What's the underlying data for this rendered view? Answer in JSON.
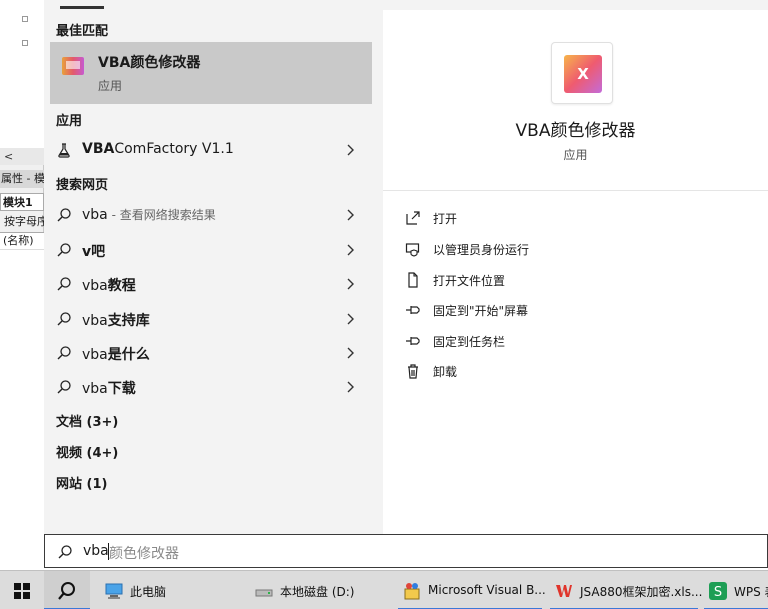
{
  "background_window": {
    "scroll_left_glyph": "<",
    "properties_title": "属性 - 模块",
    "module_name": "模块1",
    "sort_tab": "按字母序",
    "name_cell": "(名称)"
  },
  "left": {
    "best_match_header": "最佳匹配",
    "best_match": {
      "name": "VBA颜色修改器",
      "type": "应用"
    },
    "apps_header": "应用",
    "app_item": {
      "bold": "VBA",
      "rest": "ComFactory V1.1"
    },
    "web_header": "搜索网页",
    "web_items": [
      {
        "plain": "vba",
        "bold": "",
        "hint": " - 查看网络搜索结果"
      },
      {
        "plain": "",
        "bold": "v吧",
        "hint": ""
      },
      {
        "plain": "vba",
        "bold": "教程",
        "hint": ""
      },
      {
        "plain": "vba",
        "bold": "支持库",
        "hint": ""
      },
      {
        "plain": "vba",
        "bold": "是什么",
        "hint": ""
      },
      {
        "plain": "vba",
        "bold": "下载",
        "hint": ""
      }
    ],
    "docs_header": "文档 (3+)",
    "videos_header": "视频 (4+)",
    "sites_header": "网站 (1)"
  },
  "right": {
    "app_name": "VBA颜色修改器",
    "app_type": "应用",
    "icon_text": "X",
    "actions": [
      {
        "label": "打开",
        "icon": "open-icon"
      },
      {
        "label": "以管理员身份运行",
        "icon": "run-as-admin-icon"
      },
      {
        "label": "打开文件位置",
        "icon": "file-location-icon"
      },
      {
        "label": "固定到\"开始\"屏幕",
        "icon": "pin-icon"
      },
      {
        "label": "固定到任务栏",
        "icon": "pin-icon"
      },
      {
        "label": "卸载",
        "icon": "trash-icon"
      }
    ]
  },
  "search": {
    "typed": "vba",
    "suggestion": "颜色修改器"
  },
  "taskbar": [
    {
      "label": "此电脑",
      "icon": "computer-icon"
    },
    {
      "label": "本地磁盘 (D:)",
      "icon": "drive-icon"
    },
    {
      "label": "Microsoft Visual B...",
      "icon": "vb-icon"
    },
    {
      "label": "JSA880框架加密.xls...",
      "icon": "wps-icon"
    },
    {
      "label": "WPS 表",
      "icon": "wps-sheet-icon"
    }
  ],
  "colors": {
    "accent": "#3b78d8",
    "selected_bg": "#c9c9c9",
    "panel_bg": "#f3f3f3"
  }
}
